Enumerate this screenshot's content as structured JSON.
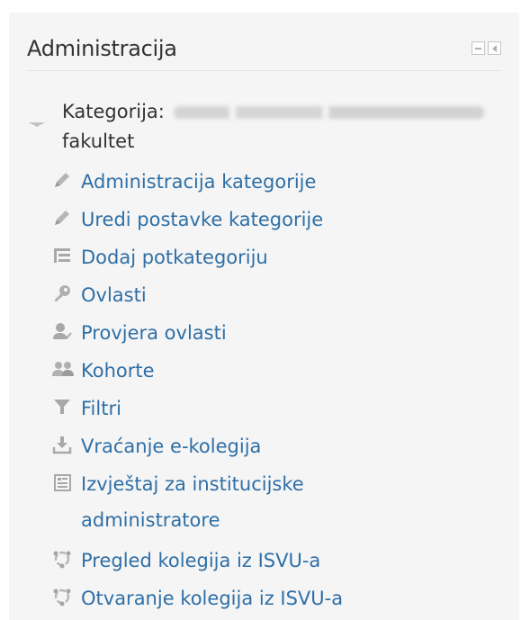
{
  "block": {
    "title": "Administracija"
  },
  "category": {
    "prefix": "Kategorija:",
    "suffix": "fakultet"
  },
  "items": [
    {
      "label": "Administracija kategorije",
      "icon": "pencil-icon"
    },
    {
      "label": "Uredi postavke kategorije",
      "icon": "pencil-icon"
    },
    {
      "label": "Dodaj potkategoriju",
      "icon": "tree-icon"
    },
    {
      "label": "Ovlasti",
      "icon": "key-icon"
    },
    {
      "label": "Provjera ovlasti",
      "icon": "user-check-icon"
    },
    {
      "label": "Kohorte",
      "icon": "users-icon"
    },
    {
      "label": "Filtri",
      "icon": "filter-icon"
    },
    {
      "label": "Vraćanje e-kolegija",
      "icon": "download-icon"
    },
    {
      "label": "Izvještaj za institucijske administratore",
      "icon": "report-icon"
    },
    {
      "label": "Pregled kolegija iz ISVU-a",
      "icon": "isvu-icon"
    },
    {
      "label": "Otvaranje kolegija iz ISVU-a",
      "icon": "isvu-icon"
    }
  ]
}
